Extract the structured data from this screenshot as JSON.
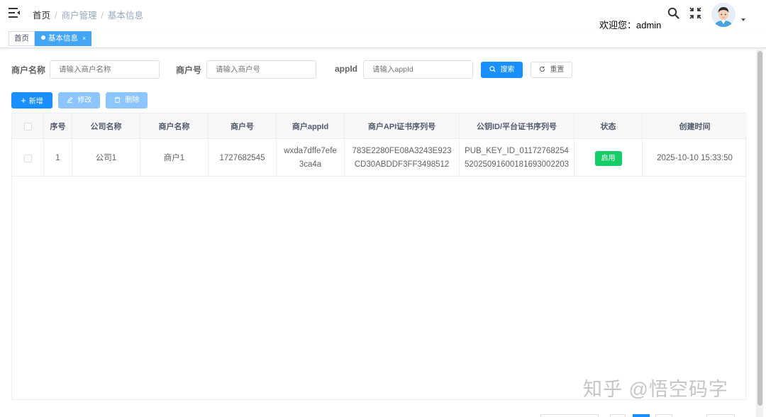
{
  "navbar": {
    "breadcrumb": [
      "首页",
      "商户管理",
      "基本信息"
    ],
    "welcome": "欢迎您：admin",
    "icons": [
      "hamburger-icon",
      "search-icon",
      "fullscreen-icon",
      "avatar",
      "caret-down-icon"
    ]
  },
  "tags": [
    {
      "label": "首页",
      "active": false
    },
    {
      "label": "基本信息",
      "active": true
    }
  ],
  "search": {
    "fields": [
      {
        "label": "商户名称",
        "placeholder": "请输入商户名称"
      },
      {
        "label": "商户号",
        "placeholder": "请输入商户号"
      },
      {
        "label": "appId",
        "placeholder": "请输入appId"
      }
    ],
    "search_label": "搜索",
    "reset_label": "重置"
  },
  "toolbar": {
    "add_label": "新增",
    "edit_label": "修改",
    "delete_label": "删除"
  },
  "table": {
    "columns": [
      "序号",
      "公司名称",
      "商户名称",
      "商户号",
      "商户appId",
      "商户API证书序列号",
      "公钥ID/平台证书序列号",
      "状态",
      "创建时间"
    ],
    "rows": [
      {
        "index": "1",
        "company": "公司1",
        "merchant": "商户1",
        "merchant_no": "1727682545",
        "appid_l1": "wxda7dffe7efe",
        "appid_l2": "3ca4a",
        "api_serial_l1": "783E2280FE08A3243E923",
        "api_serial_l2": "CD30ABDDF3FF3498512",
        "pubkey_l1": "PUB_KEY_ID_01172768254",
        "pubkey_l2": "52025091600181693002203",
        "status": "启用",
        "created": "2025-10-10 15:33:50"
      }
    ]
  },
  "watermark": "知乎 @悟空码字",
  "colors": {
    "primary": "#1890ff",
    "active_tag": "#42a5f5",
    "status_on": "#13ce66"
  }
}
